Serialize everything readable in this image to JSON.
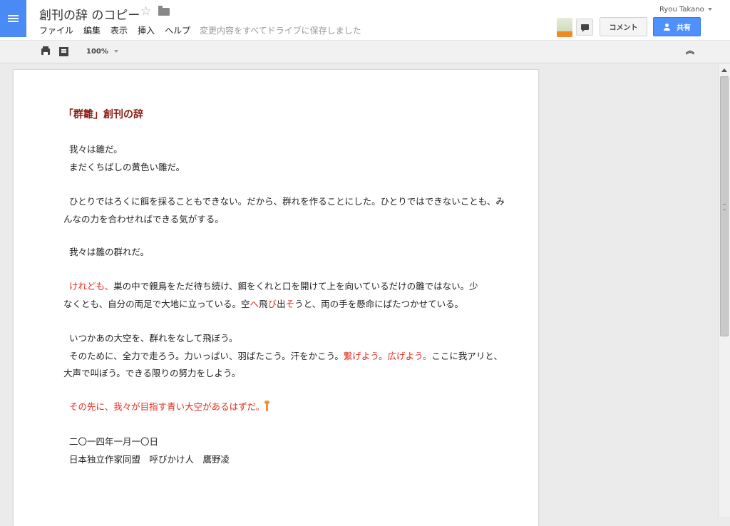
{
  "app": {
    "doc_title": "創刊の辞 のコピー",
    "menu": [
      "ファイル",
      "編集",
      "表示",
      "挿入",
      "ヘルプ"
    ],
    "save_status": "変更内容をすべてドライブに保存しました",
    "user_name": "Ryou Takano",
    "comment_label": "コメント",
    "share_label": "共有",
    "zoom": "100%"
  },
  "icons": {
    "docs": "docs-logo-icon",
    "star": "star-icon",
    "folder": "folder-icon",
    "print": "print-icon",
    "outline": "outline-icon",
    "chat": "chat-icon",
    "collapse": "collapse-icon"
  },
  "colors": {
    "accent": "#4a8af4",
    "share_button": "#4d90fe",
    "title_text": "#8b1a10",
    "highlight_text": "#e8291c",
    "cursor": "#f0922d"
  },
  "document": {
    "title": "「群雛」創刊の辞",
    "p1_line1": "我々は雛だ。",
    "p1_line2": "まだくちばしの黄色い雛だ。",
    "p2_line1": "ひとりではろくに餌を採ることもできない。だから、群れを作ることにした。ひとりではできないことも、み",
    "p2_line2": "んなの力を合わせればできる気がする。",
    "p3": "我々は雛の群れだ。",
    "p4_line1_red": "けれども、",
    "p4_line1_rest": "巣の中で親鳥をただ待ち続け、餌をくれと口を開けて上を向いているだけの雛ではない。少",
    "p4_line2_a": "なくとも、自分の両足で大地に立っている。空",
    "p4_line2_red1": "へ",
    "p4_line2_b": "飛",
    "p4_line2_red2": "び",
    "p4_line2_c": "出",
    "p4_line2_red3": "そ",
    "p4_line2_d": "うと、両の手を懸命にばたつかせている。",
    "p5_line1": "いつかあの大空を、群れをなして飛ぼう。",
    "p5_line2_a": "そのために、全力で走ろう。力いっぱい、羽ばたこう。汗をかこう。",
    "p5_line2_red": "繋げよう。広げよう。",
    "p5_line2_b": "ここに我アリと、",
    "p5_line3": "大声で叫ぼう。できる限りの努力をしよう。",
    "p6_red": "その先に、我々が目指す青い大空があるはずだ。",
    "date": "二〇一四年一月一〇日",
    "signature": "日本独立作家同盟　呼びかけ人　鷹野凌"
  }
}
